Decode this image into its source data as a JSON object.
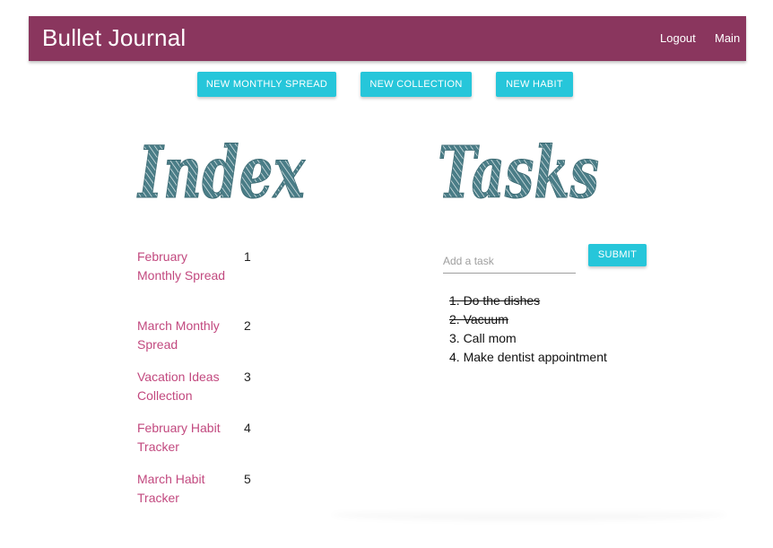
{
  "navbar": {
    "brand": "Bullet Journal",
    "links": [
      "Logout",
      "Main"
    ],
    "color": "#8a365e"
  },
  "toolbar": {
    "buttons": [
      "NEW MONTHLY SPREAD",
      "NEW COLLECTION",
      "NEW HABIT"
    ],
    "accent": "#26c6da"
  },
  "index": {
    "heading": "Index",
    "items": [
      {
        "label": "February Monthly Spread",
        "number": "1"
      },
      {
        "label": "March Monthly Spread",
        "number": "2"
      },
      {
        "label": "Vacation Ideas Collection",
        "number": "3"
      },
      {
        "label": "February Habit Tracker",
        "number": "4"
      },
      {
        "label": "March Habit Tracker",
        "number": "5"
      }
    ],
    "link_color": "#c2497f"
  },
  "tasks": {
    "heading": "Tasks",
    "input_placeholder": "Add a task",
    "submit_label": "SUBMIT",
    "items": [
      {
        "text": "1. Do the dishes",
        "completed": true
      },
      {
        "text": "2. Vacuum",
        "completed": true
      },
      {
        "text": "3. Call mom",
        "completed": false
      },
      {
        "text": "4. Make dentist appointment",
        "completed": false
      }
    ]
  },
  "heading_color": "#4a7d87"
}
